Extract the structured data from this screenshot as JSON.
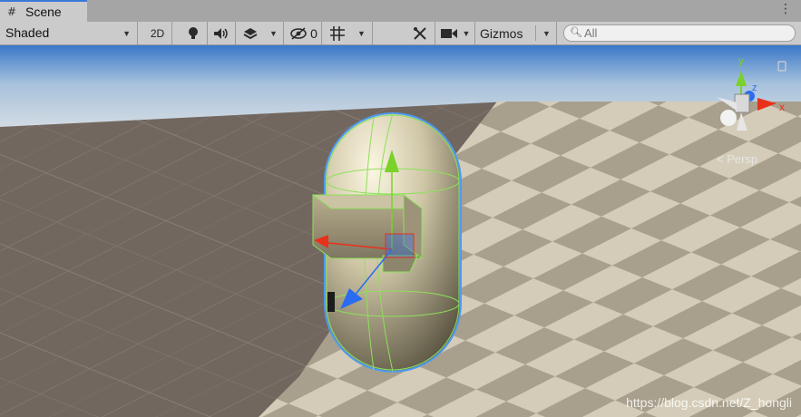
{
  "tab": {
    "icon": "grid-icon",
    "label": "Scene",
    "menu_icon": "kebab-menu-icon",
    "accent": "#3a79d8"
  },
  "toolbar": {
    "draw_mode": "Shaded",
    "mode_2d": "2D",
    "hidden_count": "0",
    "gizmos_label": "Gizmos",
    "search_placeholder": "All"
  },
  "viewport": {
    "projection_label": "< Persp",
    "axis_labels": {
      "x": "x",
      "y": "y",
      "z": "z"
    },
    "watermark": "https://blog.csdn.net/Z_hongli",
    "colors": {
      "sky_top": "#3a78c9",
      "horizon": "#d6dde3",
      "ground_dark": "#756b63",
      "tile_light": "#d8d0bd",
      "tile_dark": "#a69e8b",
      "x_axis": "#e8311b",
      "y_axis": "#7ad12a",
      "z_axis": "#2a6cf0",
      "selection_outline": "#4d9bf3"
    }
  }
}
